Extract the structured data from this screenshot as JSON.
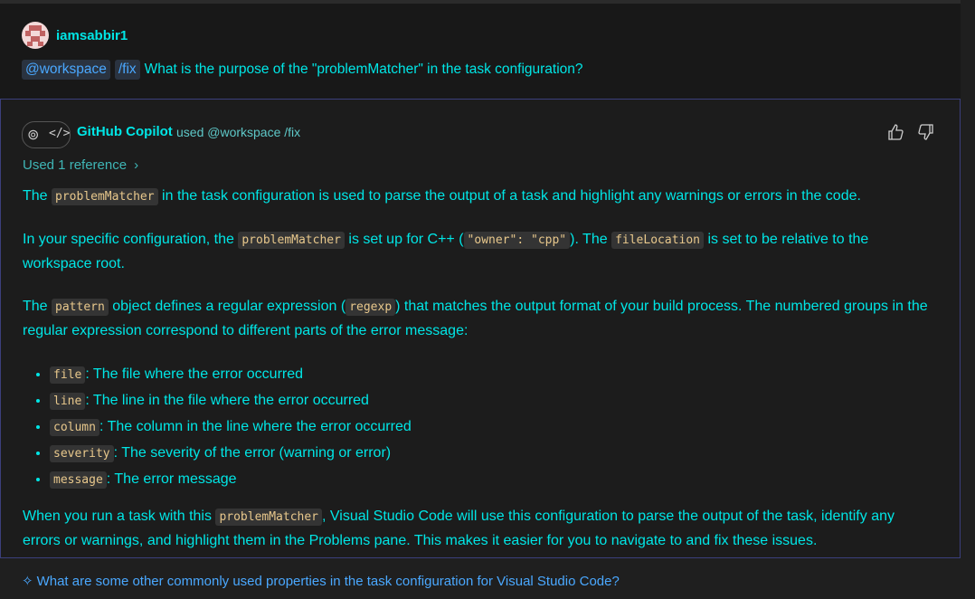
{
  "user": {
    "name": "iamsabbir1",
    "chips": [
      "@workspace",
      "/fix"
    ],
    "question": "What is the purpose of the \"problemMatcher\" in the task configuration?"
  },
  "response": {
    "agent_name": "GitHub Copilot",
    "used_text": "used @workspace /fix",
    "reference_label": "Used 1 reference",
    "p1": {
      "a": "The ",
      "code": "problemMatcher",
      "b": " in the task configuration is used to parse the output of a task and highlight any warnings or errors in the code."
    },
    "p2": {
      "a": "In your specific configuration, the ",
      "code1": "problemMatcher",
      "b": " is set up for C++ (",
      "code2": "\"owner\": \"cpp\"",
      "c": "). The ",
      "code3": "fileLocation",
      "d": " is set to be relative to the workspace root."
    },
    "p3": {
      "a": "The ",
      "code1": "pattern",
      "b": " object defines a regular expression (",
      "code2": "regexp",
      "c": ") that matches the output format of your build process. The numbered groups in the regular expression correspond to different parts of the error message:"
    },
    "list": [
      {
        "code": "file",
        "text": ": The file where the error occurred"
      },
      {
        "code": "line",
        "text": ": The line in the file where the error occurred"
      },
      {
        "code": "column",
        "text": ": The column in the line where the error occurred"
      },
      {
        "code": "severity",
        "text": ": The severity of the error (warning or error)"
      },
      {
        "code": "message",
        "text": ": The error message"
      }
    ],
    "p4": {
      "a": "When you run a task with this ",
      "code": "problemMatcher",
      "b": ", Visual Studio Code will use this configuration to parse the output of the task, identify any errors or warnings, and highlight them in the Problems pane. This makes it easier for you to navigate to and fix these issues."
    }
  },
  "suggestion": "What are some other commonly used properties in the task configuration for Visual Studio Code?",
  "icons": {
    "thumbs_up": "thumbs-up-icon",
    "thumbs_down": "thumbs-down-icon",
    "sparkle": "sparkle-icon",
    "chevron": "chevron-right-icon"
  },
  "colors": {
    "accent_text": "#00e6e6",
    "link": "#4aa8ff",
    "code_text": "#e8c88c",
    "response_border": "#3b3f7c"
  }
}
